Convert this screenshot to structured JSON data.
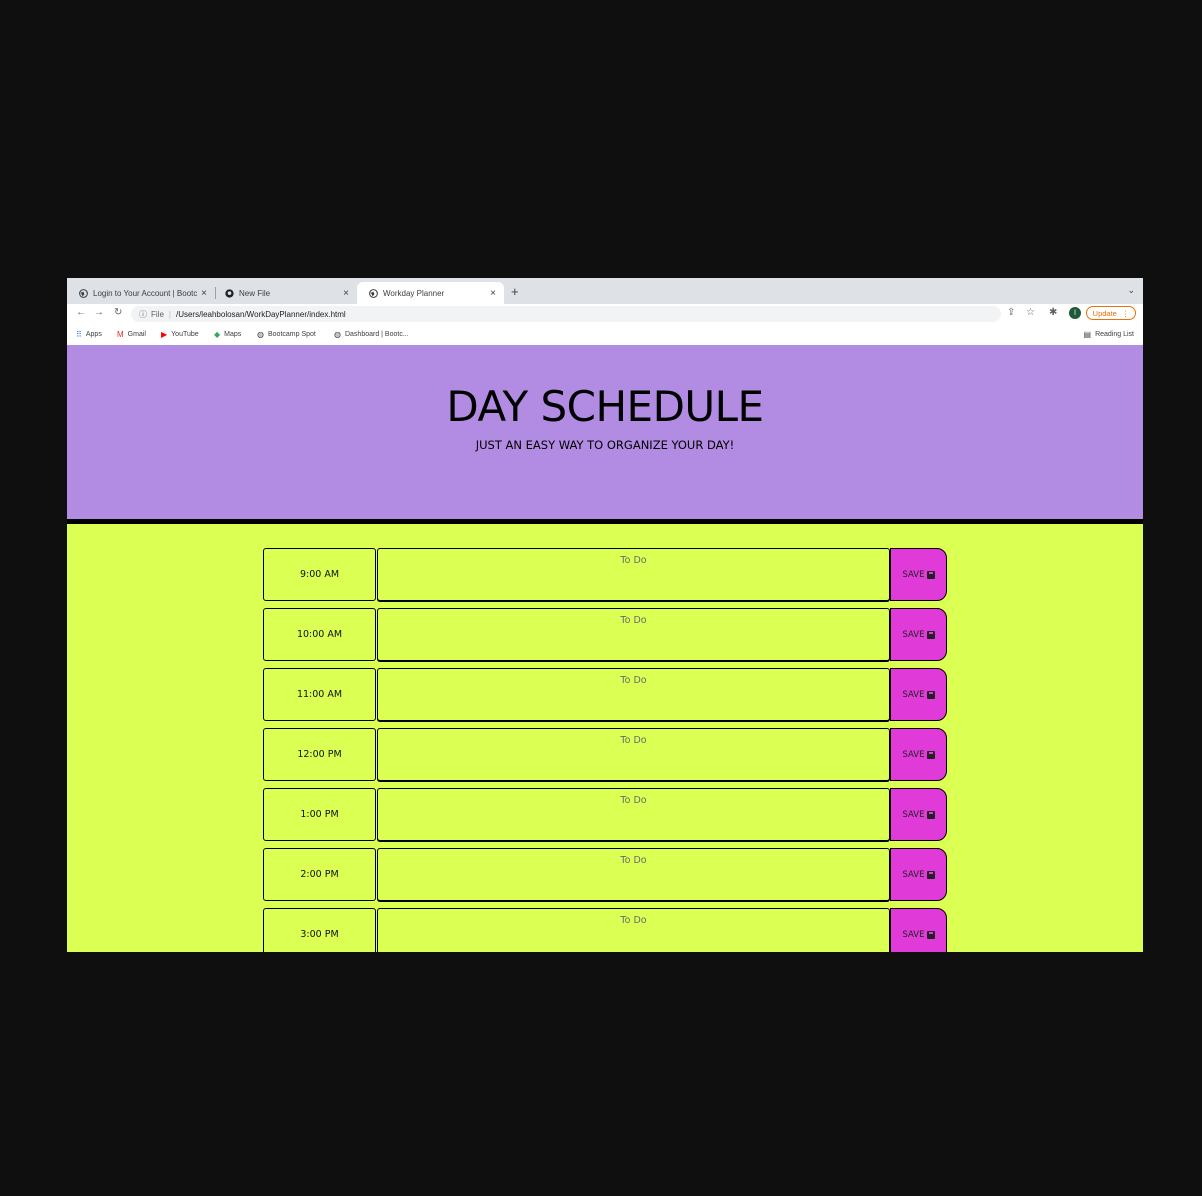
{
  "browser": {
    "tabs": [
      {
        "title": "Login to Your Account | Bootca",
        "favicon": "globe-icon",
        "active": false
      },
      {
        "title": "New File",
        "favicon": "github-icon",
        "active": false
      },
      {
        "title": "Workday Planner",
        "favicon": "globe-icon",
        "active": true
      }
    ],
    "url_scheme": "File",
    "url": "/Users/leahbolosan/WorkDayPlanner/index.html",
    "avatar_initial": "l",
    "update_label": "Update",
    "bookmarks": [
      {
        "label": "Apps",
        "icon": "apps-grid-icon"
      },
      {
        "label": "Gmail",
        "icon": "gmail-icon"
      },
      {
        "label": "YouTube",
        "icon": "youtube-icon"
      },
      {
        "label": "Maps",
        "icon": "maps-icon"
      },
      {
        "label": "Bootcamp Spot",
        "icon": "globe-icon"
      },
      {
        "label": "Dashboard | Bootc...",
        "icon": "globe-icon"
      }
    ],
    "reading_list_label": "Reading List"
  },
  "header": {
    "title": "DAY SCHEDULE",
    "subtitle": "JUST AN EASY WAY TO ORGANIZE YOUR DAY!",
    "background": "#b28be3"
  },
  "schedule": {
    "placeholder": "To Do",
    "save_label": "SAVE",
    "rows": [
      {
        "hour": "9:00 AM"
      },
      {
        "hour": "10:00 AM"
      },
      {
        "hour": "11:00 AM"
      },
      {
        "hour": "12:00 PM"
      },
      {
        "hour": "1:00 PM"
      },
      {
        "hour": "2:00 PM"
      },
      {
        "hour": "3:00 PM"
      }
    ],
    "row_color": "#dbff53",
    "save_color": "#e03ad8"
  }
}
